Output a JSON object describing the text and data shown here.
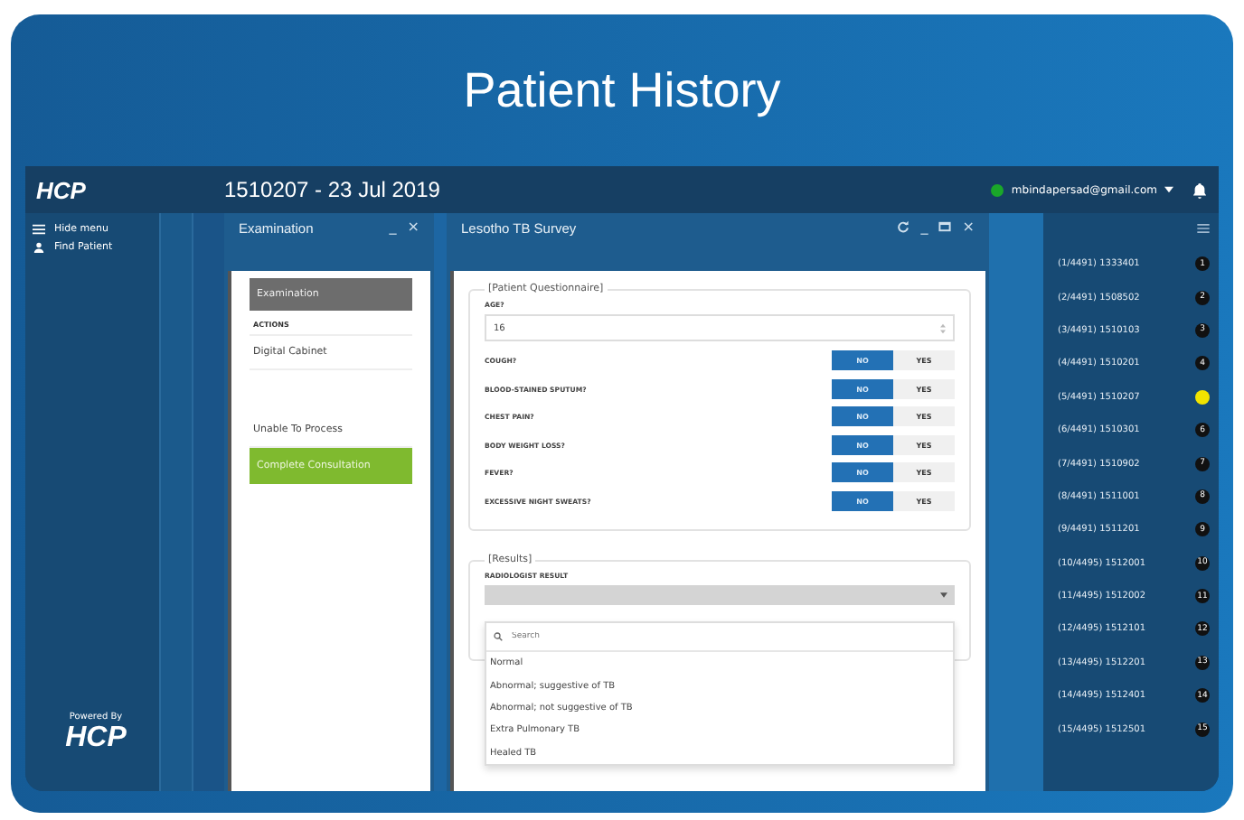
{
  "title": "Patient History",
  "topbar": {
    "logo": "HCP",
    "record": "1510207 - 23 Jul 2019",
    "user": "mbindapersad@gmail.com",
    "online": true
  },
  "sidebar": {
    "items": [
      {
        "label": "Hide menu"
      },
      {
        "label": "Find Patient"
      }
    ],
    "powered_by": "Powered By",
    "footer_logo": "HCP"
  },
  "examination": {
    "title": "Examination",
    "minimize": "_",
    "close": "×",
    "current": "Examination",
    "actions_label": "ACTIONS",
    "actions": [
      {
        "label": "Digital Cabinet",
        "kind": "plain"
      },
      {
        "label": "Unable To Process",
        "kind": "plain"
      },
      {
        "label": "Complete Consultation",
        "kind": "primary"
      }
    ]
  },
  "survey": {
    "title": "Lesotho TB Survey",
    "minimize": "_",
    "close": "×",
    "questionnaire": {
      "legend": "[Patient Questionnaire]",
      "age_label": "AGE?",
      "age_value": "16",
      "questions": [
        {
          "label": "COUGH?",
          "options": [
            {
              "label": "NO",
              "selected": true
            },
            {
              "label": "YES",
              "selected": false
            }
          ]
        },
        {
          "label": "BLOOD-STAINED SPUTUM?",
          "options": [
            {
              "label": "NO",
              "selected": true
            },
            {
              "label": "YES",
              "selected": false
            }
          ]
        },
        {
          "label": "CHEST PAIN?",
          "options": [
            {
              "label": "NO",
              "selected": true
            },
            {
              "label": "YES",
              "selected": false
            }
          ]
        },
        {
          "label": "BODY WEIGHT LOSS?",
          "options": [
            {
              "label": "NO",
              "selected": true
            },
            {
              "label": "YES",
              "selected": false
            }
          ]
        },
        {
          "label": "FEVER?",
          "options": [
            {
              "label": "NO",
              "selected": true
            },
            {
              "label": "YES",
              "selected": false
            }
          ]
        },
        {
          "label": "EXCESSIVE NIGHT SWEATS?",
          "options": [
            {
              "label": "NO",
              "selected": true
            },
            {
              "label": "YES",
              "selected": false
            }
          ]
        }
      ]
    },
    "results": {
      "legend": "[Results]",
      "field_label": "RADIOLOGIST RESULT",
      "search_placeholder": "Search",
      "options": [
        "Normal",
        "Abnormal; suggestive of TB",
        "Abnormal; not suggestive of TB",
        "Extra Pulmonary TB",
        "Healed TB"
      ]
    }
  },
  "queue": [
    {
      "label": "(1/4491) 1333401",
      "badge": "1",
      "color": "#111111"
    },
    {
      "label": "(2/4491) 1508502",
      "badge": "2",
      "color": "#111111"
    },
    {
      "label": "(3/4491) 1510103",
      "badge": "3",
      "color": "#111111"
    },
    {
      "label": "(4/4491) 1510201",
      "badge": "4",
      "color": "#111111"
    },
    {
      "label": "(5/4491) 1510207",
      "color": "#f2e400"
    },
    {
      "label": "(6/4491) 1510301",
      "badge": "6",
      "color": "#111111"
    },
    {
      "label": "(7/4491) 1510902",
      "badge": "7",
      "color": "#111111"
    },
    {
      "label": "(8/4491) 1511001",
      "badge": "8",
      "color": "#111111"
    },
    {
      "label": "(9/4491) 1511201",
      "badge": "9",
      "color": "#111111"
    },
    {
      "label": "(10/4495) 1512001",
      "badge": "10",
      "color": "#111111"
    },
    {
      "label": "(11/4495) 1512002",
      "badge": "11",
      "color": "#111111"
    },
    {
      "label": "(12/4495) 1512101",
      "badge": "12",
      "color": "#111111"
    },
    {
      "label": "(13/4495) 1512201",
      "badge": "13",
      "color": "#111111"
    },
    {
      "label": "(14/4495) 1512401",
      "badge": "14",
      "color": "#111111"
    },
    {
      "label": "(15/4495) 1512501",
      "badge": "15",
      "color": "#111111"
    }
  ]
}
